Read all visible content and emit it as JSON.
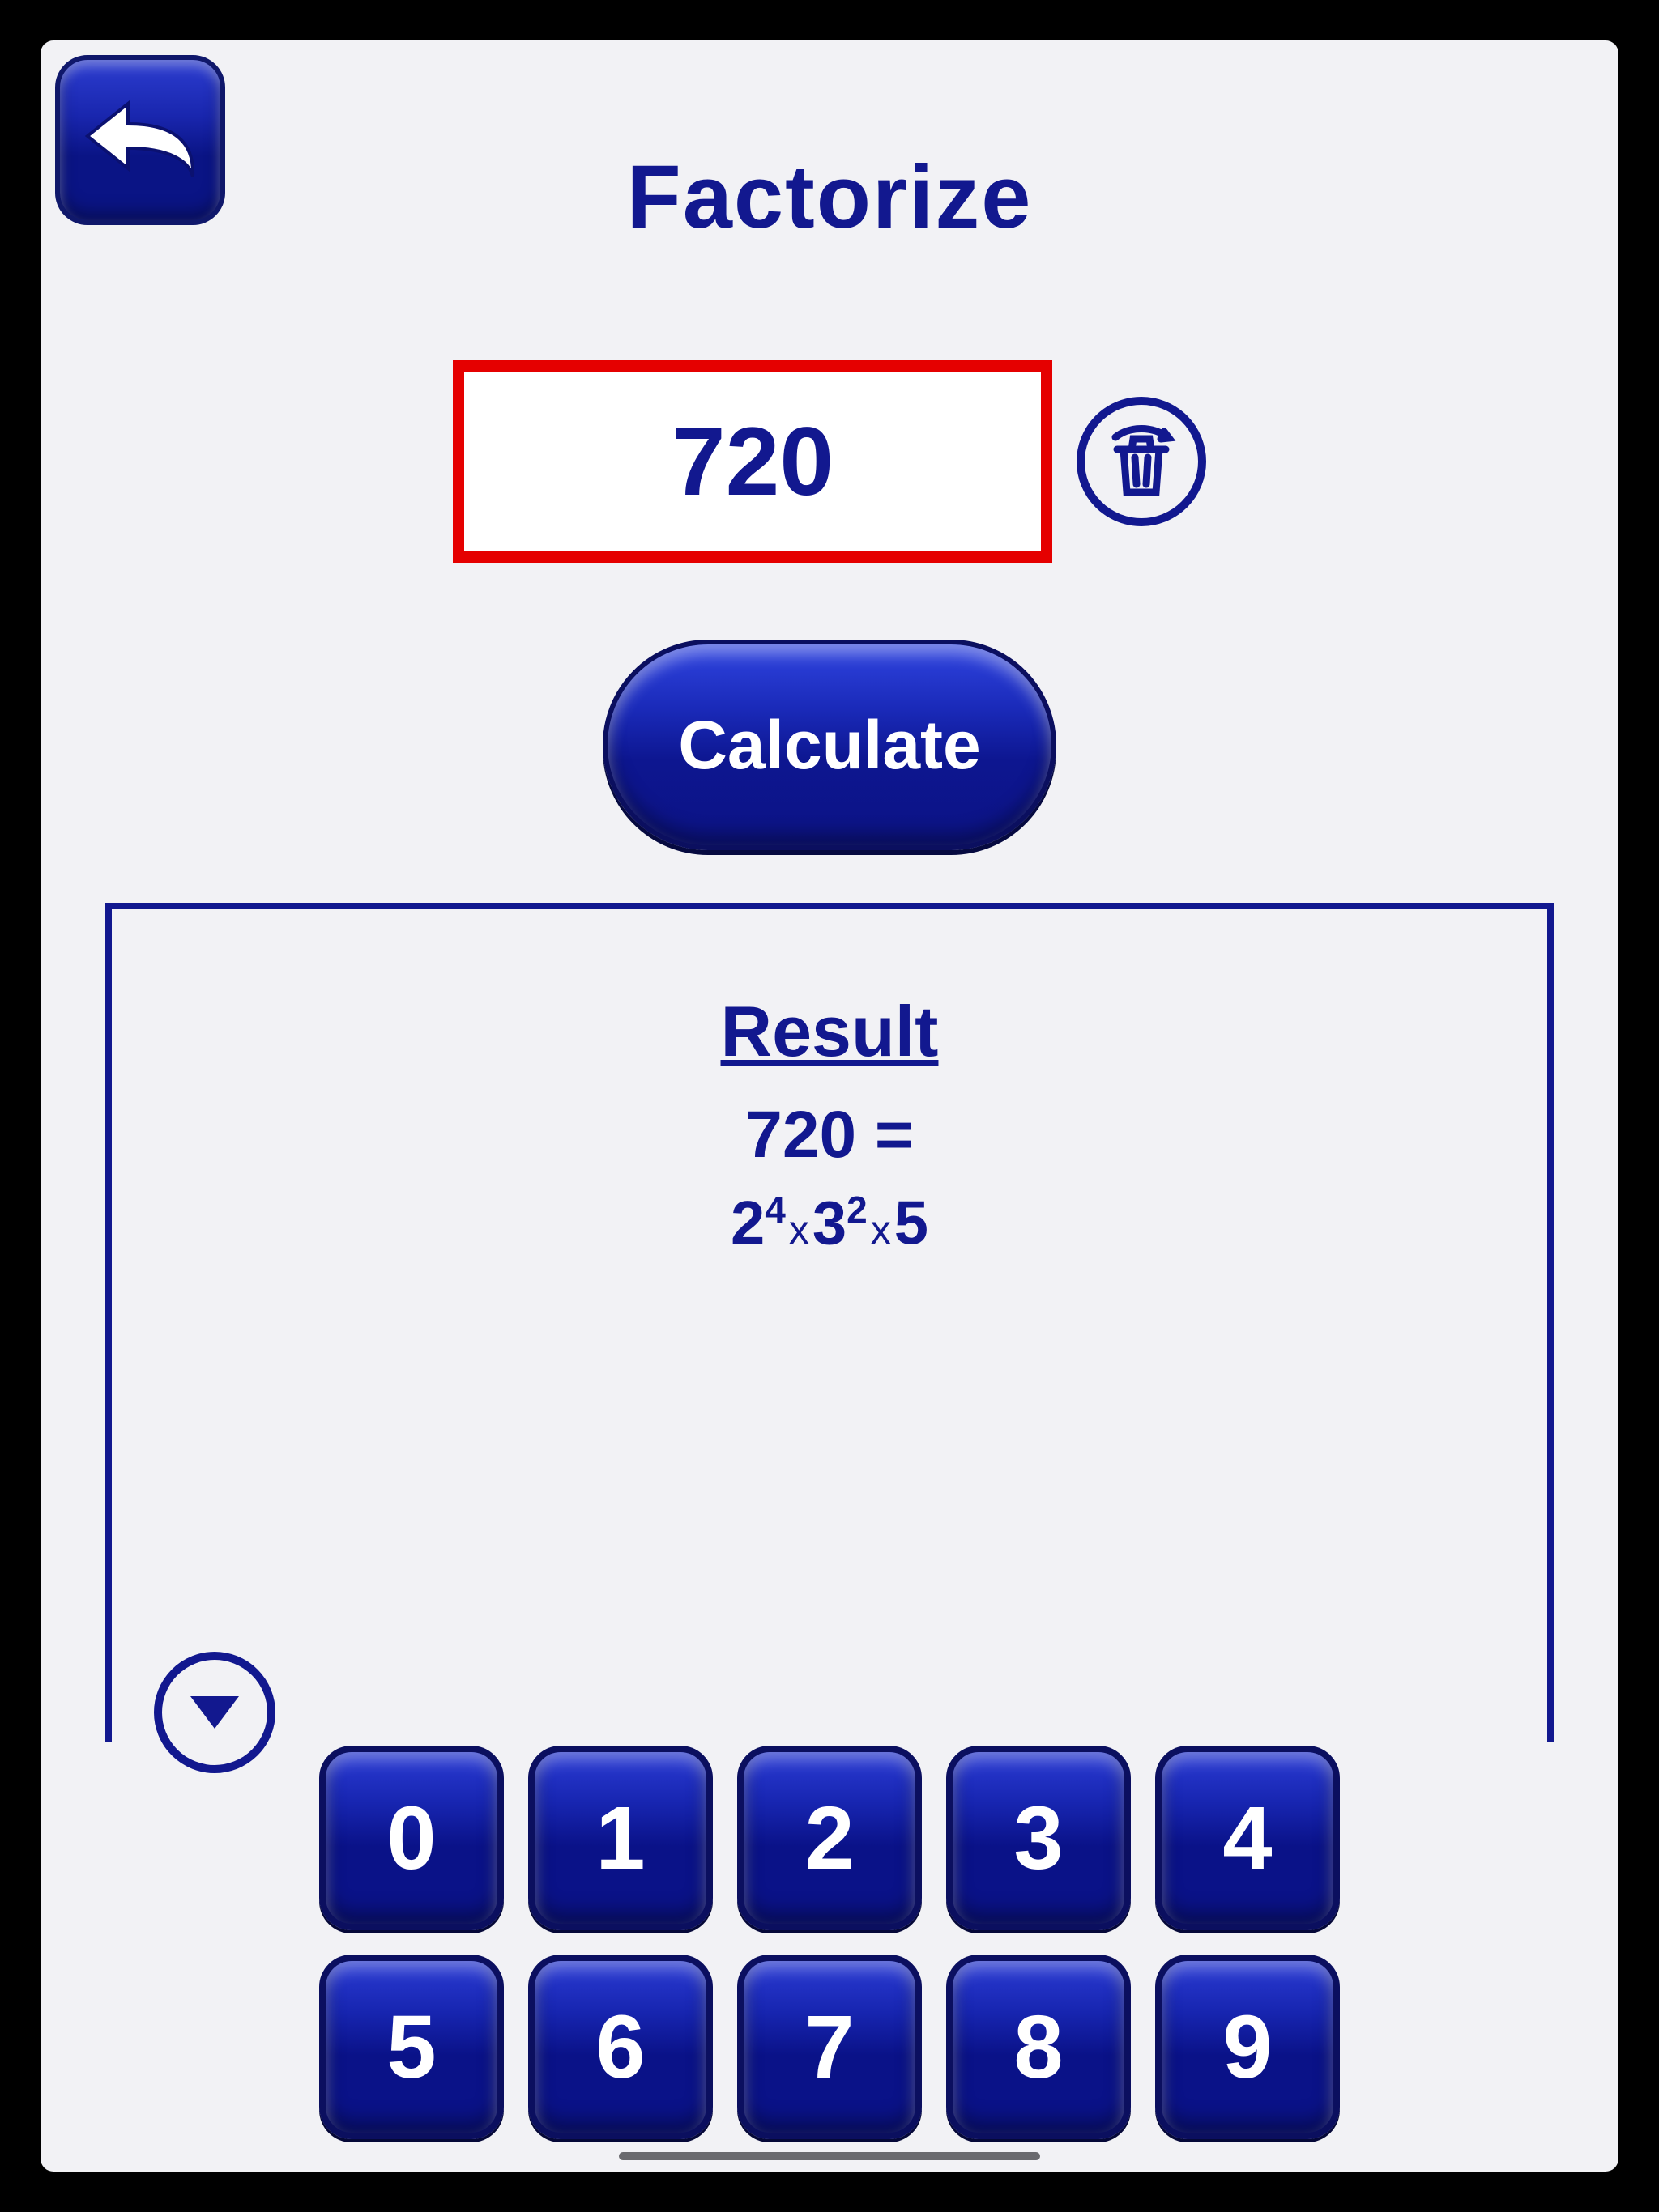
{
  "title": "Factorize",
  "input_value": "720",
  "calculate_label": "Calculate",
  "result": {
    "heading": "Result",
    "line1": "720 =",
    "factors": [
      {
        "base": "2",
        "exp": "4"
      },
      {
        "base": "3",
        "exp": "2"
      },
      {
        "base": "5",
        "exp": ""
      }
    ]
  },
  "keypad": {
    "row1": [
      "0",
      "1",
      "2",
      "3",
      "4"
    ],
    "row2": [
      "5",
      "6",
      "7",
      "8",
      "9"
    ]
  }
}
